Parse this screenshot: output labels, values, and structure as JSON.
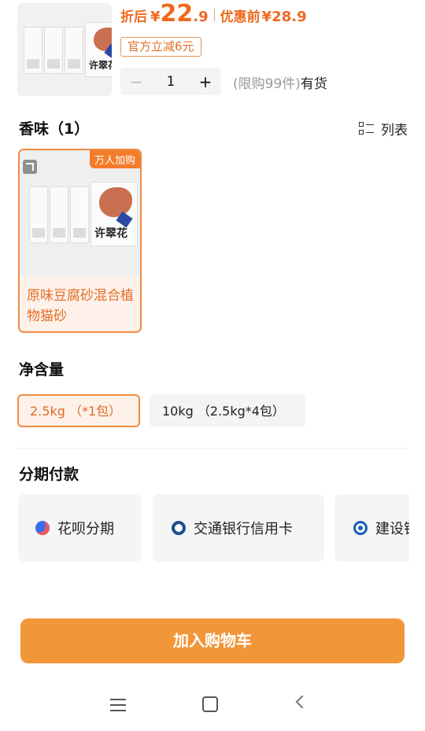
{
  "product": {
    "thumb_brand": "许翠花",
    "price_label": "折后",
    "currency": "¥",
    "price_int": "22",
    "price_dec": ".9",
    "orig_label": "优惠前",
    "orig_price": "¥28.9",
    "coupon": "官方立减6元",
    "qty": "1",
    "minus": "−",
    "plus": "+",
    "limit": "(限购99件)",
    "stock": "有货",
    "accent": "#ee6a1f"
  },
  "flavor": {
    "title": "香味（1）",
    "list_toggle": "列表",
    "items": [
      {
        "badge": "万人加购",
        "name": "原味豆腐砂混合植物猫砂",
        "brand": "许翠花"
      }
    ]
  },
  "weight": {
    "title": "净含量",
    "options": [
      {
        "label": "2.5kg （*1包）",
        "selected": true
      },
      {
        "label": "10kg （2.5kg*4包）",
        "selected": false
      }
    ]
  },
  "installment": {
    "title": "分期付款",
    "options": [
      {
        "label": "花呗分期",
        "icon": "huabei-icon"
      },
      {
        "label": "交通银行信用卡",
        "icon": "bocom-icon"
      },
      {
        "label": "建设银行",
        "icon": "ccb-icon"
      }
    ]
  },
  "cart_button": "加入购物车"
}
